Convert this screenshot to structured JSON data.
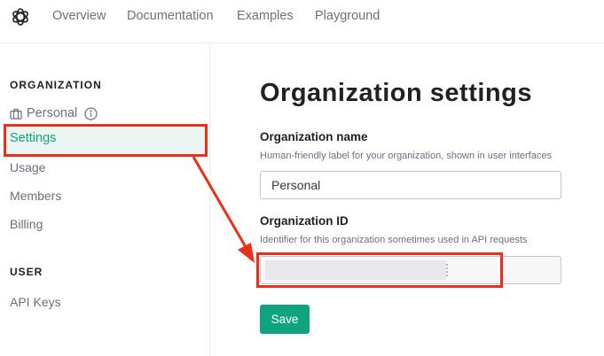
{
  "header": {
    "logo_icon": "openai-logo-icon",
    "nav": [
      "Overview",
      "Documentation",
      "Examples",
      "Playground"
    ]
  },
  "sidebar": {
    "organization_heading": "ORGANIZATION",
    "org_name": "Personal",
    "org_icon": "briefcase-icon",
    "info_icon": "info-icon",
    "items": [
      "Settings",
      "Usage",
      "Members",
      "Billing"
    ],
    "user_heading": "USER",
    "user_items": [
      "API Keys"
    ]
  },
  "main": {
    "title": "Organization settings",
    "org_name_label": "Organization name",
    "org_name_help": "Human-friendly label for your organization, shown in user interfaces",
    "org_name_value": "Personal",
    "org_id_label": "Organization ID",
    "org_id_help": "Identifier for this organization sometimes used in API requests",
    "save_label": "Save"
  },
  "annotation": {
    "color": "#e8301a",
    "type": "red-highlight-boxes-with-arrow"
  },
  "colors": {
    "accent": "#10a37f",
    "active_bg": "#ebf6f3",
    "annotation": "#e8301a"
  }
}
